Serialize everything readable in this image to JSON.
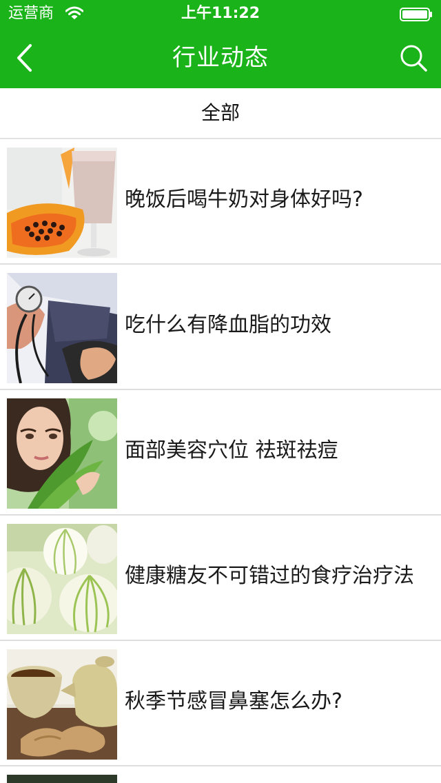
{
  "status_bar": {
    "carrier": "运营商",
    "time": "上午11:22"
  },
  "nav": {
    "title": "行业动态",
    "back_icon": "chevron-left-icon",
    "search_icon": "search-icon"
  },
  "tabs": {
    "active": "全部"
  },
  "articles": [
    {
      "title": "晚饭后喝牛奶对身体好吗?",
      "image": "papaya-milkshake"
    },
    {
      "title": "吃什么有降血脂的功效",
      "image": "blood-pressure-cuff"
    },
    {
      "title": "面部美容穴位 祛斑祛痘",
      "image": "woman-with-leaves"
    },
    {
      "title": "健康糖友不可错过的食疗治疗法",
      "image": "onions"
    },
    {
      "title": "秋季节感冒鼻塞怎么办?",
      "image": "ginger-tea"
    }
  ],
  "colors": {
    "brand_green": "#1ab41a",
    "divider": "#dedede"
  }
}
